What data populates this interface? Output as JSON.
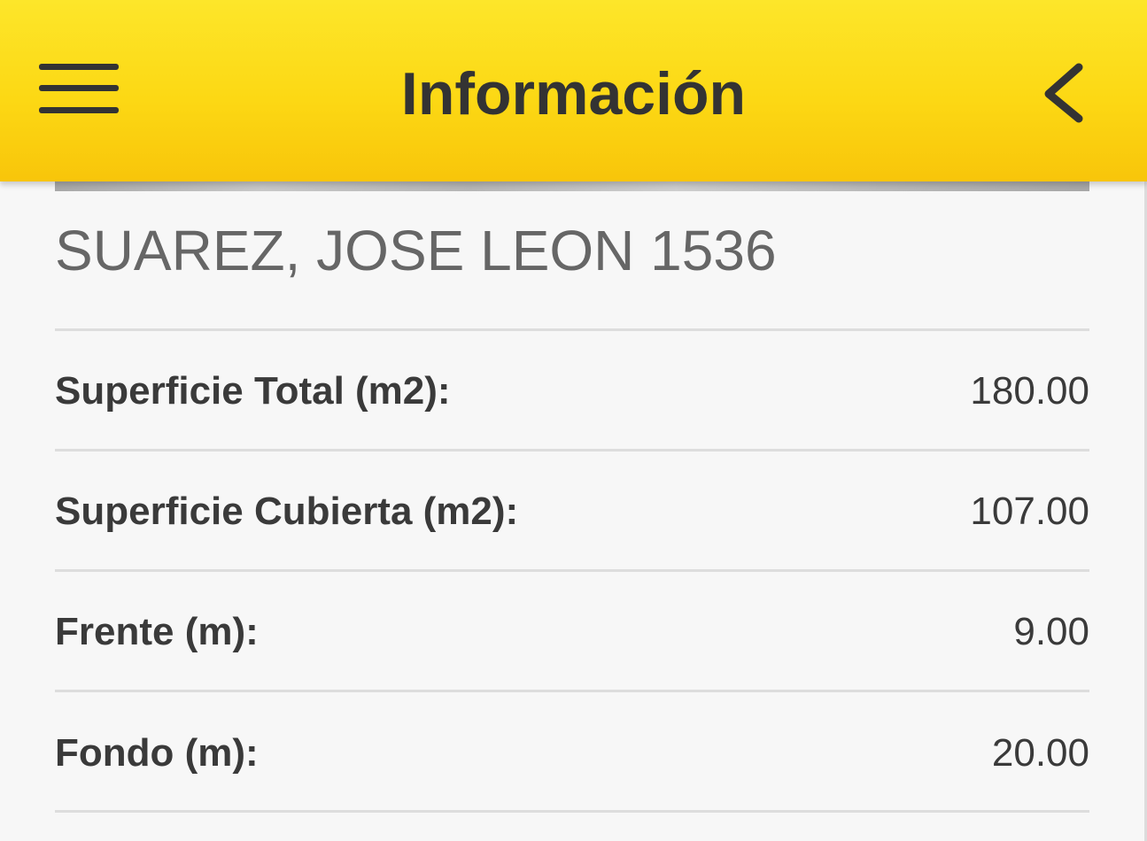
{
  "header": {
    "title": "Información",
    "menu_icon": "hamburger-menu-icon",
    "back_icon": "chevron-left-icon",
    "background_color": "#fcd814",
    "text_color": "#333333"
  },
  "property": {
    "address": "SUAREZ, JOSE LEON 1536"
  },
  "details": [
    {
      "label": "Superficie Total (m2):",
      "value": "180.00"
    },
    {
      "label": "Superficie Cubierta (m2):",
      "value": "107.00"
    },
    {
      "label": "Frente (m):",
      "value": "9.00"
    },
    {
      "label": "Fondo (m):",
      "value": "20.00"
    }
  ]
}
